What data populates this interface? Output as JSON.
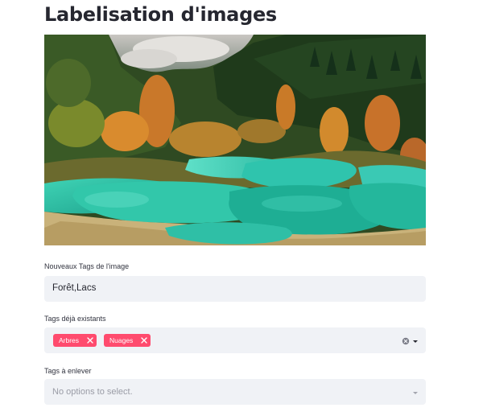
{
  "page": {
    "title": "Labelisation d'images"
  },
  "image": {
    "alt": "Paysage de forêt et de lacs"
  },
  "new_tags": {
    "label": "Nouveaux Tags de l'image",
    "value": "Forêt,Lacs"
  },
  "existing_tags": {
    "label": "Tags déjà existants",
    "tags": [
      {
        "text": "Arbres"
      },
      {
        "text": "Nuages"
      }
    ]
  },
  "remove_tags": {
    "label": "Tags à enlever",
    "placeholder": "No options to select."
  },
  "colors": {
    "tag_bg": "#ff4b6e",
    "field_bg": "#f0f2f6",
    "text": "#262730"
  }
}
